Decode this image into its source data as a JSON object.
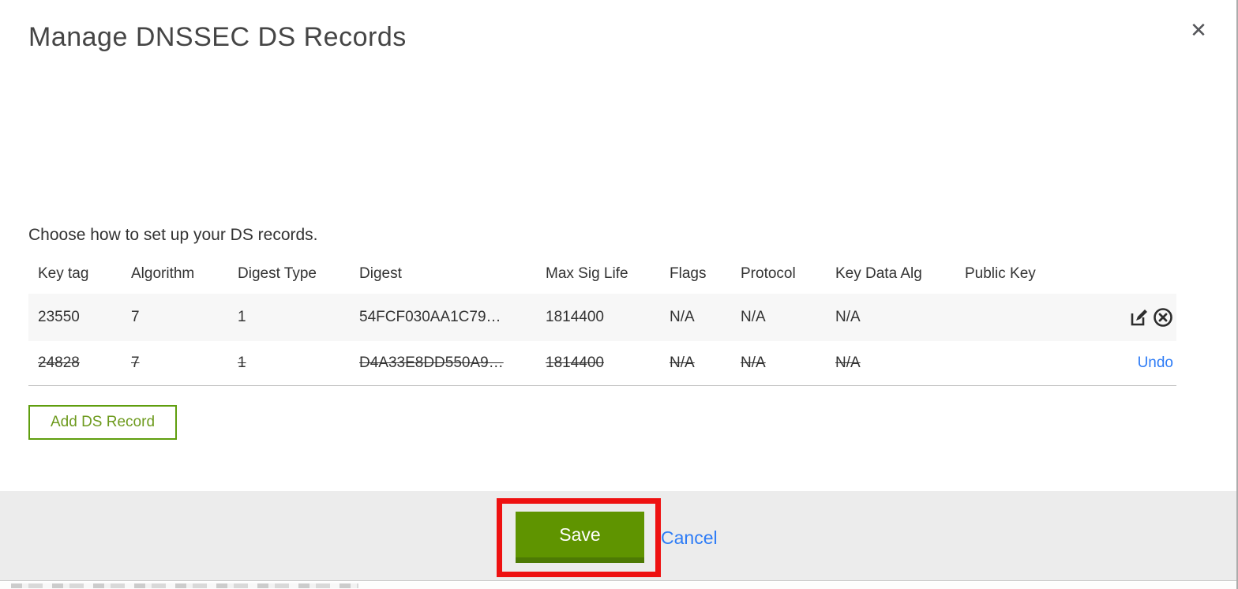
{
  "modal": {
    "title": "Manage DNSSEC DS Records",
    "close_icon": "✕",
    "instruction": "Choose how to set up your DS records.",
    "table": {
      "columns": [
        "Key tag",
        "Algorithm",
        "Digest Type",
        "Digest",
        "Max Sig Life",
        "Flags",
        "Protocol",
        "Key Data Alg",
        "Public Key"
      ],
      "rows": [
        {
          "key_tag": "23550",
          "algorithm": "7",
          "digest_type": "1",
          "digest": "54FCF030AA1C79…",
          "max_sig_life": "1814400",
          "flags": "N/A",
          "protocol": "N/A",
          "key_data_alg": "N/A",
          "public_key": "",
          "state": "active",
          "actions": [
            "edit-icon",
            "delete-icon"
          ]
        },
        {
          "key_tag": "24828",
          "algorithm": "7",
          "digest_type": "1",
          "digest": "D4A33E8DD550A9…",
          "max_sig_life": "1814400",
          "flags": "N/A",
          "protocol": "N/A",
          "key_data_alg": "N/A",
          "public_key": "",
          "state": "deleted",
          "action_label": "Undo"
        }
      ]
    },
    "add_button_label": "Add DS Record",
    "footer": {
      "save_label": "Save",
      "cancel_label": "Cancel"
    },
    "colors": {
      "button_green": "#5f9400",
      "button_green_dark": "#4d7a04",
      "outline_green": "#5f9e0e",
      "link_blue": "#2e7cf6",
      "annotation_red": "#ee1111",
      "row_highlight": "#f7f7f7",
      "footer_gray": "#ececec"
    }
  }
}
